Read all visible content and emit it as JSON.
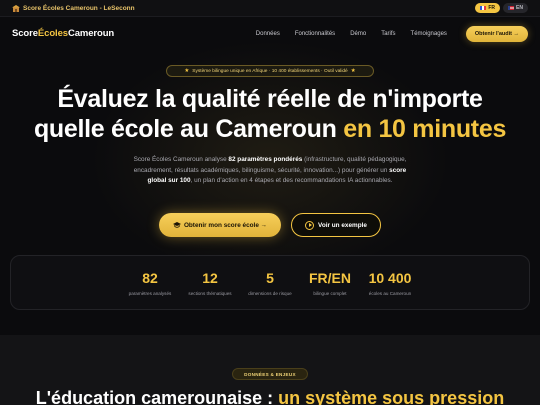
{
  "topbar": {
    "title": "Score Écoles Cameroun - LeSeconn",
    "lang_fr": "FR",
    "lang_en": "EN"
  },
  "nav": {
    "logo_part1": "Score",
    "logo_part2": "Écoles",
    "logo_part3": "Cameroun",
    "links": [
      "Données",
      "Fonctionnalités",
      "Démo",
      "Tarifs",
      "Témoignages"
    ],
    "cta": "Obtenir l'audit →"
  },
  "hero": {
    "badge": "Système bilingue unique en Afrique · 10 400 établissements · Outil validé",
    "headline_line1": "Évaluez la qualité réelle de n'importe",
    "headline_line2_white": "quelle école au Cameroun",
    "headline_line2_gold": "en 10 minutes",
    "sub_1": "Score Écoles Cameroun analyse ",
    "sub_bold1": "82 paramètres pondérés",
    "sub_2": " (infrastructure, qualité pédagogique, encadrement, résultats académiques, bilinguisme, sécurité, innovation...) pour générer un ",
    "sub_bold2": "score global sur 100",
    "sub_3": ", un plan d'action en 4 étapes et des recommandations IA actionnables.",
    "primary_button": "Obtenir mon score école →",
    "secondary_button": "Voir un exemple"
  },
  "stats": [
    {
      "value": "82",
      "label": "paramètres analysés"
    },
    {
      "value": "12",
      "label": "sections thématiques"
    },
    {
      "value": "5",
      "label": "dimensions de risque"
    },
    {
      "value": "FR/EN",
      "label": "bilingue complet"
    },
    {
      "value": "10 400",
      "label": "écoles au Cameroun"
    }
  ],
  "section2": {
    "tag": "DONNÉES & ENJEUX",
    "title_white": "L'éducation camerounaise : ",
    "title_gold": "un système sous pression"
  },
  "colors": {
    "accent": "#f4c542",
    "background": "#0b0b0d"
  }
}
